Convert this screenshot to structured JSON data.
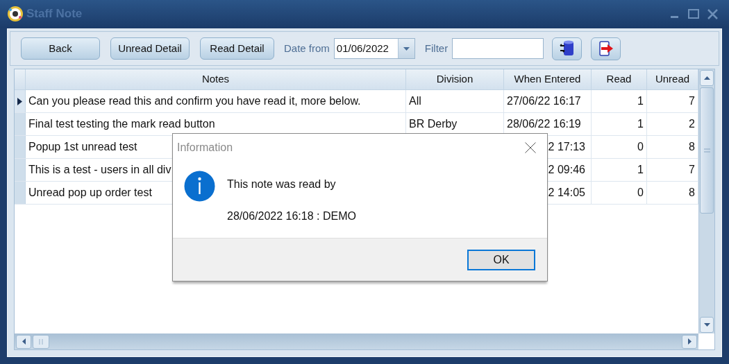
{
  "window": {
    "title": "Staff Note"
  },
  "toolbar": {
    "buttons": [
      "Back",
      "Unread Detail",
      "Read Detail"
    ],
    "date_label": "Date from",
    "date_value": "01/06/2022",
    "filter_label": "Filter"
  },
  "table": {
    "columns": [
      "Notes",
      "Division",
      "When Entered",
      "Read",
      "Unread"
    ],
    "rows": [
      {
        "selected": true,
        "cells": [
          "Can you please read this and confirm you have read it, more below.",
          "All",
          "27/06/22 16:17",
          "1",
          "7"
        ]
      },
      {
        "selected": false,
        "cells": [
          "Final test testing the mark read button",
          "BR Derby",
          "28/06/22 16:19",
          "1",
          "2"
        ]
      },
      {
        "selected": false,
        "cells": [
          "Popup 1st unread test",
          null,
          "2 17:13",
          "0",
          "8"
        ]
      },
      {
        "selected": false,
        "cells": [
          "This is a test - users in all div",
          null,
          "2 09:46",
          "1",
          "7"
        ]
      },
      {
        "selected": false,
        "cells": [
          "Unread pop up order test",
          null,
          "2 14:05",
          "0",
          "8"
        ]
      }
    ]
  },
  "dialog": {
    "title": "Information",
    "message": "This note was read by",
    "detail": "28/06/2022 16:18 : DEMO",
    "button": "OK"
  }
}
